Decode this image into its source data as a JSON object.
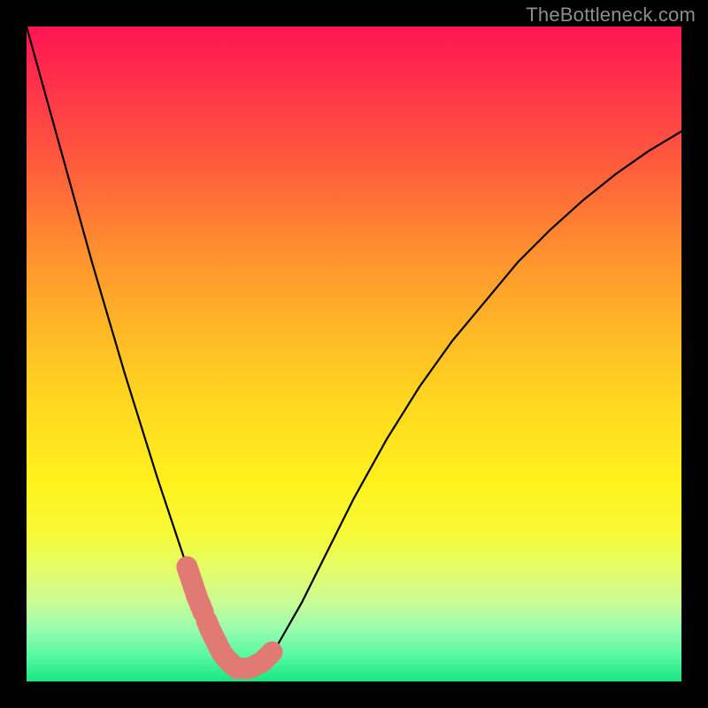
{
  "domain": "Chart",
  "watermark": "TheBottleneck.com",
  "colors": {
    "curve": "#000000",
    "markers": "#e27a74",
    "frame_bg_top": "#ff1552",
    "frame_bg_bottom": "#18e783",
    "page_bg": "#000000",
    "watermark": "#8d8d8d"
  },
  "chart_data": {
    "type": "line",
    "title": "",
    "xlabel": "",
    "ylabel": "",
    "xlim": [
      0,
      100
    ],
    "ylim": [
      0,
      100
    ],
    "x": [
      0,
      5,
      10,
      15,
      20,
      24,
      26,
      28,
      30,
      32,
      34,
      36,
      38,
      42,
      46,
      50,
      55,
      60,
      65,
      70,
      75,
      80,
      85,
      90,
      95,
      100
    ],
    "values": [
      100,
      82,
      64,
      47,
      31,
      19,
      13,
      8,
      4,
      2,
      2,
      3,
      5,
      12,
      20,
      28,
      37,
      45,
      52,
      58,
      64,
      69,
      73.5,
      77.5,
      81,
      84
    ],
    "highlight_x_ranges": [
      [
        24.5,
        27.0
      ],
      [
        27.5,
        34.5
      ],
      [
        35.0,
        37.5
      ]
    ],
    "notes": "Values are percentages (0 = bottom/green, 100 = top/red). x is an arbitrary 0–100 parameter. Highlighted ranges are drawn as thick salmon segments near the curve's minimum."
  }
}
